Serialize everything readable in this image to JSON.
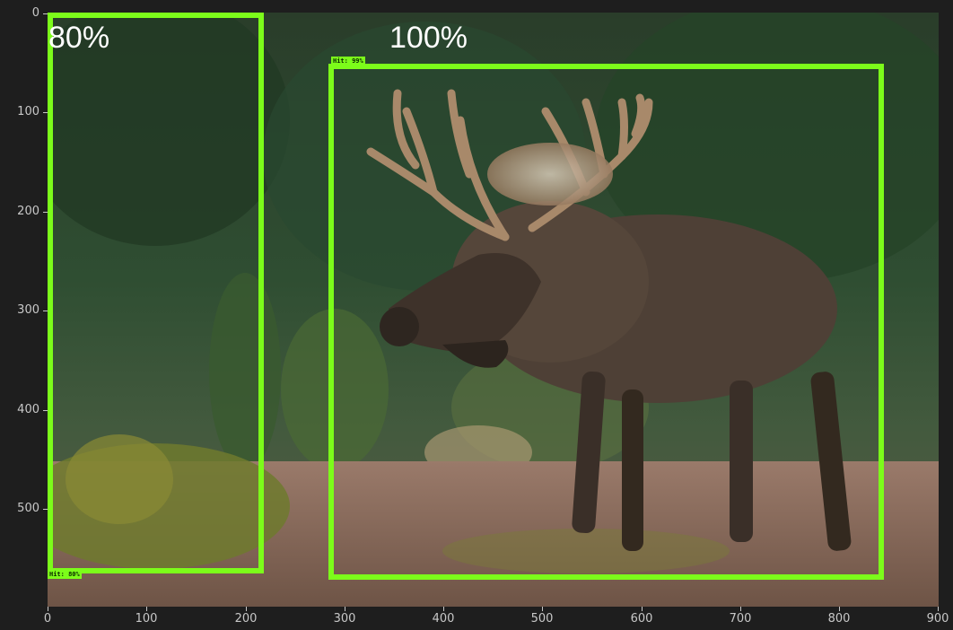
{
  "image": {
    "subject": "moose",
    "colors": {
      "box": "#7cfc1a",
      "forest": "#2c4a2a",
      "ground": "#8a6a58"
    }
  },
  "detections": [
    {
      "tag": "Hit: 80%",
      "overlay": "80%"
    },
    {
      "tag": "Hit: 99%",
      "overlay": "100%"
    }
  ],
  "axes": {
    "x_ticks": [
      "0",
      "100",
      "200",
      "300",
      "400",
      "500",
      "600",
      "700",
      "800",
      "900"
    ],
    "y_ticks": [
      "0",
      "100",
      "200",
      "300",
      "400",
      "500"
    ]
  }
}
